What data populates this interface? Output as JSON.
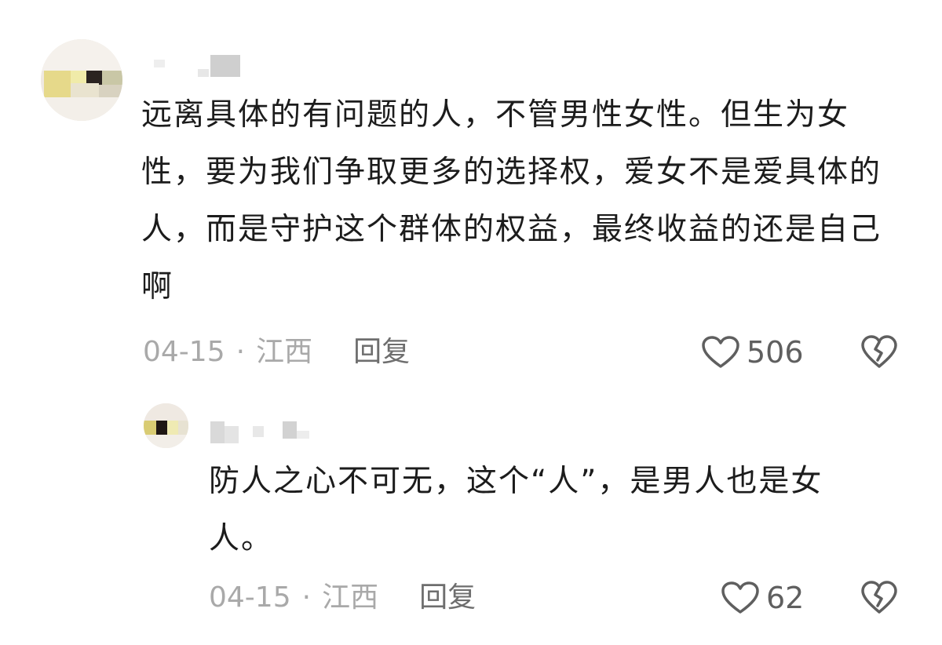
{
  "comment": {
    "text": "远离具体的有问题的人，不管男性女性。但生为女性，要为我们争取更多的选择权，爱女不是爱具体的人，而是守护这个群体的权益，最终收益的还是自己啊",
    "date": "04-15",
    "separator": "·",
    "location": "江西",
    "reply_label": "回复",
    "likes": "506",
    "like_icon": "heart-outline-icon",
    "dislike_icon": "broken-heart-icon"
  },
  "reply": {
    "text": "防人之心不可无，这个“人”，是男人也是女人。",
    "date": "04-15",
    "separator": "·",
    "location": "江西",
    "reply_label": "回复",
    "likes": "62",
    "like_icon": "heart-outline-icon",
    "dislike_icon": "broken-heart-icon"
  },
  "colors": {
    "text": "#1c1c1c",
    "meta": "#a9a9a9",
    "reply_button": "#6e6e6e",
    "icon": "#5f5f5f"
  }
}
